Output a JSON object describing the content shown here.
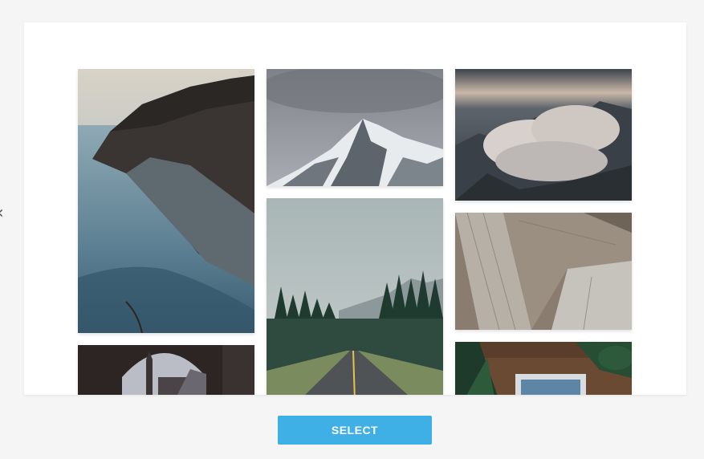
{
  "side_glyph": "‹",
  "photos": [
    {
      "label": "sea-cliff-photo",
      "icon": "photo-sea-cliff"
    },
    {
      "label": "snowy-mountain-photo",
      "icon": "photo-snowy-mountain"
    },
    {
      "label": "cloud-peaks-photo",
      "icon": "photo-cloud-peaks"
    },
    {
      "label": "forest-road-photo",
      "icon": "photo-forest-road"
    },
    {
      "label": "wooden-planks-photo",
      "icon": "photo-wooden-planks"
    },
    {
      "label": "arch-clocktower-photo",
      "icon": "photo-arch-clocktower"
    },
    {
      "label": "plants-frame-photo",
      "icon": "photo-plants-frame"
    }
  ],
  "select_button": {
    "label": "SELECT"
  },
  "colors": {
    "accent": "#3fb0e6"
  }
}
